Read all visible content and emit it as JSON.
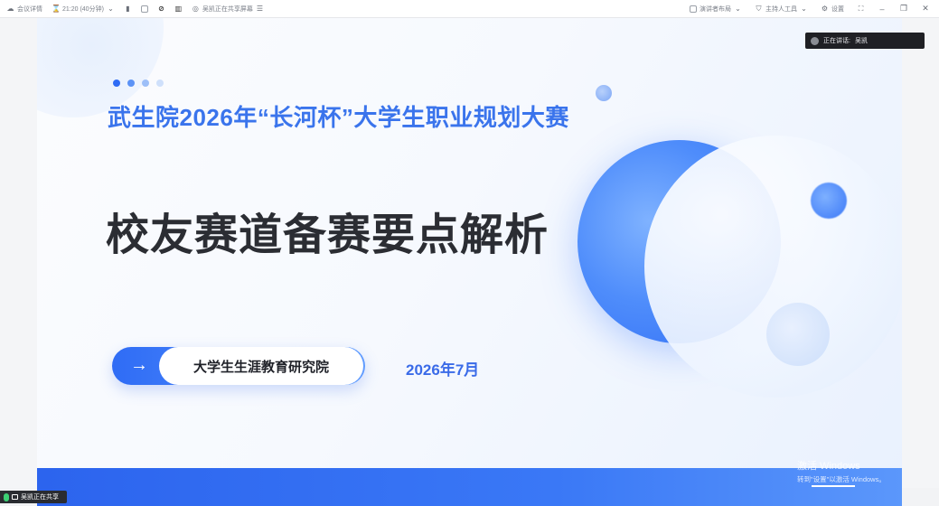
{
  "topbar": {
    "meeting_details": "会议详情",
    "time": "21:20 (40分钟)",
    "sharing_status": "吴凯正在共享屏幕",
    "presenter_layout": "演讲者布局",
    "host_tools": "主持人工具",
    "settings": "设置",
    "icons": [
      "meeting-logo-icon",
      "clock-icon",
      "chevron-down-icon",
      "signal-icon",
      "popout-icon",
      "slash-icon",
      "network-icon",
      "share-screen-icon",
      "menu-icon",
      "layout-icon",
      "shield-icon",
      "gear-icon",
      "fullscreen-icon",
      "minimize-icon",
      "restore-icon",
      "close-icon"
    ]
  },
  "speaking_banner": {
    "label": "正在讲话:",
    "speaker": "吴凯"
  },
  "slide": {
    "subtitle": "武生院2026年“长河杯”大学生职业规划大赛",
    "title": "校友赛道备赛要点解析",
    "arrow": "→",
    "organizer": "大学生生涯教育研究院",
    "date": "2026年7月",
    "dot_colors": [
      "#2f6cf5",
      "#5b92f6",
      "#9dbff8",
      "#cfe0fb"
    ]
  },
  "watermark": {
    "line1": "激活 Windows",
    "line2": "转到\"设置\"以激活 Windows。"
  },
  "share_bar": {
    "label": "吴凯正在共享"
  }
}
